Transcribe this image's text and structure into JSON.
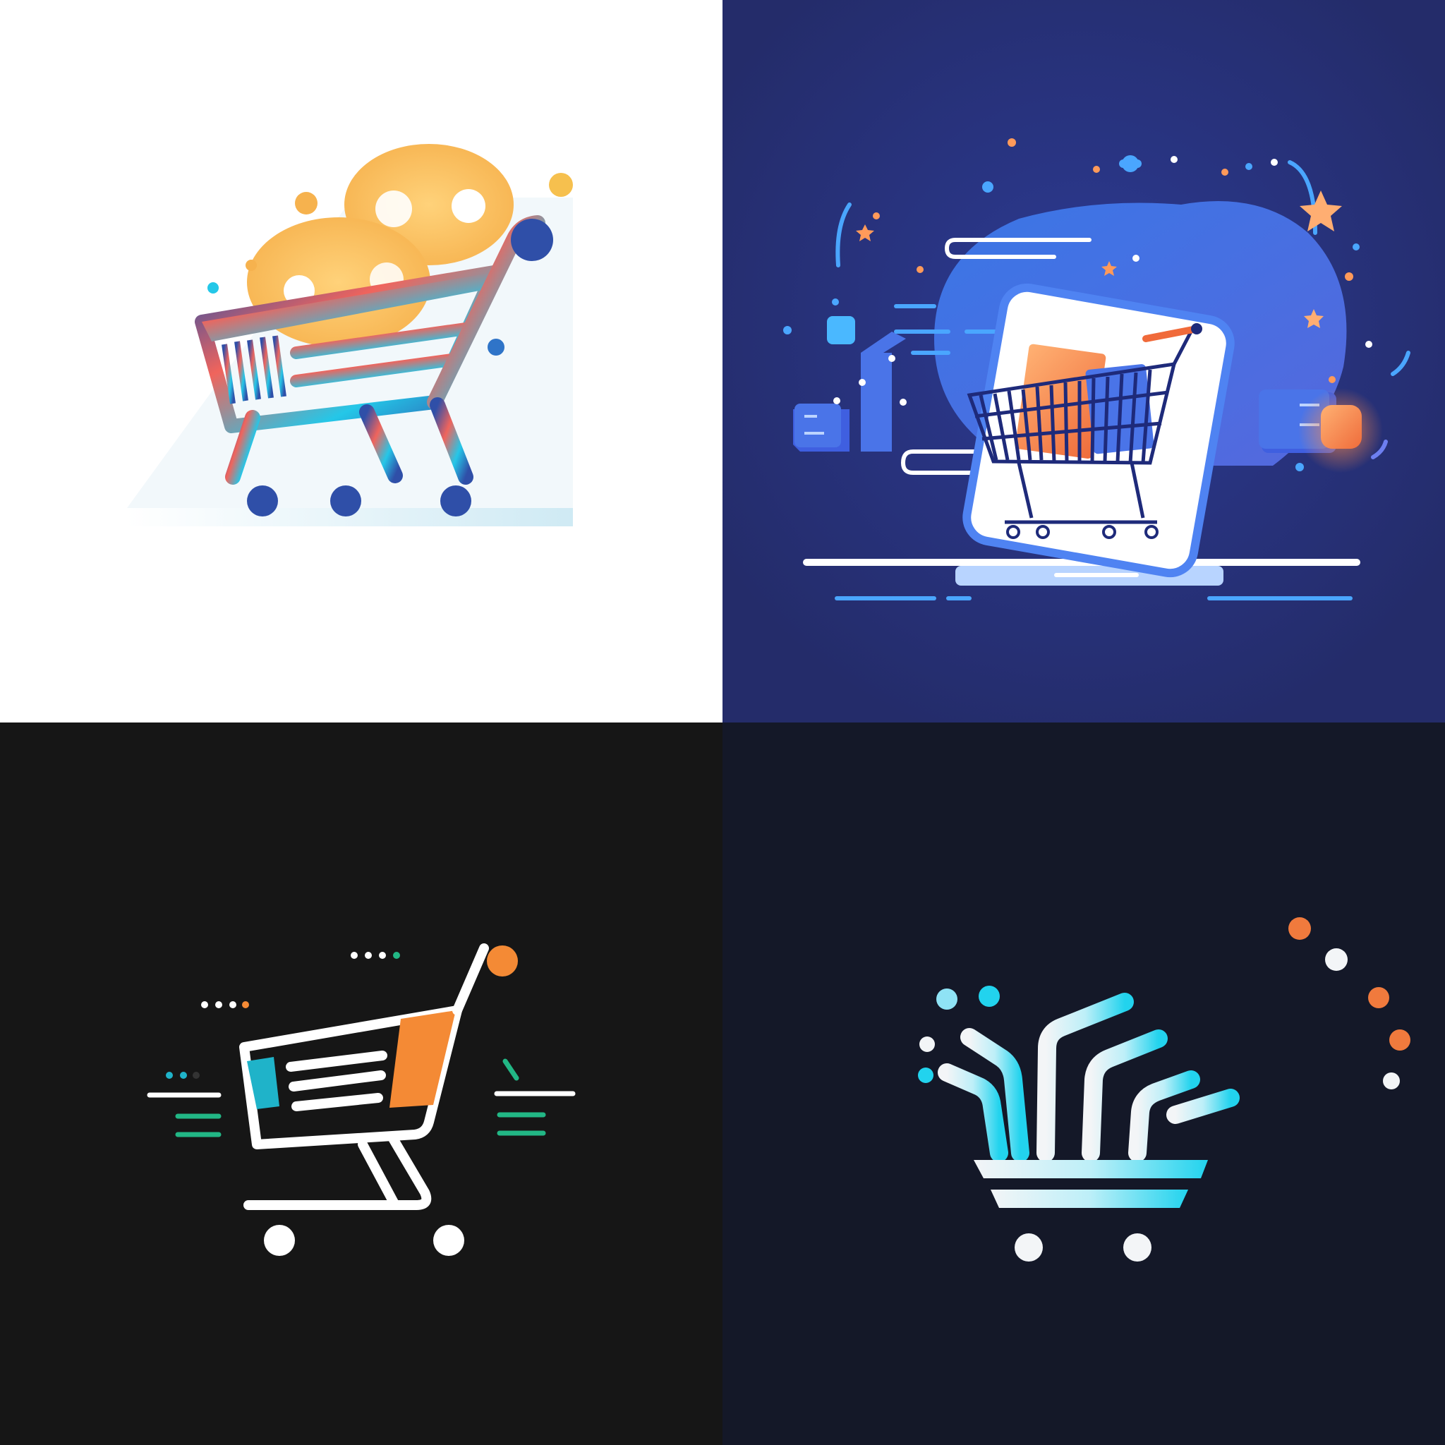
{
  "tiles": [
    {
      "id": "tile-1",
      "description_icon": "cart-with-orange-bubbles-icon",
      "background": "#ffffff",
      "colors": {
        "accent_orange": "#f6b24e",
        "gradient_red": "#f0645c",
        "gradient_blue": "#2f4fa8",
        "gradient_cyan": "#24c7e8",
        "floor": "#cfeaf4"
      }
    },
    {
      "id": "tile-2",
      "description_icon": "phone-cart-scene-icon",
      "background": "#26306f",
      "colors": {
        "glow_blue": "#4f83f2",
        "phone_white": "#ffffff",
        "orange": "#f58a4a",
        "box_blue": "#4a74e8",
        "line_blue": "#4aa6ff"
      }
    },
    {
      "id": "tile-3",
      "description_icon": "line-cart-orange-dot-icon",
      "background": "#161616",
      "colors": {
        "white": "#ffffff",
        "orange": "#f48a35",
        "cyan": "#1fb3c9",
        "green": "#22b785"
      }
    },
    {
      "id": "tile-4",
      "description_icon": "abstract-cart-logo-icon",
      "background": "#141828",
      "colors": {
        "white": "#f3f5f7",
        "cyan": "#22d3ee",
        "orange": "#f07a3d",
        "light_cyan": "#8fe3f5"
      }
    }
  ]
}
